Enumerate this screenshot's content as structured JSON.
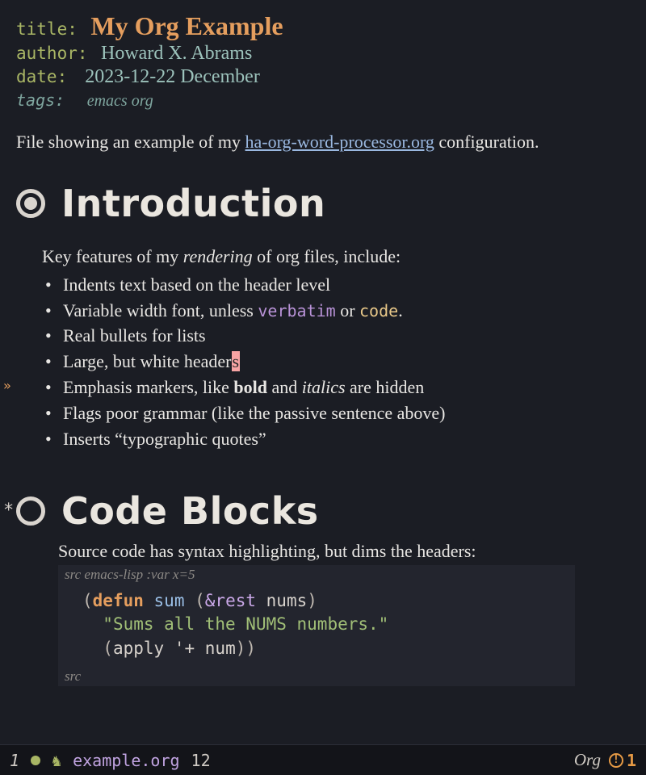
{
  "meta": {
    "title_key": "title:",
    "title_val": "My Org Example",
    "author_key": "author:",
    "author_val": "Howard X. Abrams",
    "date_key": "date:",
    "date_val": "2023-12-22 December",
    "tags_key": "tags:",
    "tags_val": "emacs org"
  },
  "intro_para_pre": "File showing an example of my ",
  "intro_link_text": "ha-org-word-processor.org",
  "intro_para_post": " configuration.",
  "section1": {
    "heading": "Introduction",
    "lead_pre": "Key features of my ",
    "lead_em": "rendering",
    "lead_post": " of org files, include:",
    "items": {
      "i0": "Indents text based on the header level",
      "i1_pre": "Variable width font, unless ",
      "i1_verb": "verbatim",
      "i1_mid": " or ",
      "i1_code": "code",
      "i1_post": ".",
      "i2": "Real bullets for lists",
      "i3_pre": "Large, but white header",
      "i3_cursor": "s",
      "i4_pre": "Emphasis markers, like ",
      "i4_bold": "bold",
      "i4_mid": " and ",
      "i4_ital": "italics",
      "i4_post": " are hidden",
      "i5": "Flags poor grammar (like the passive sentence above)",
      "i6": "Inserts “typographic quotes”"
    }
  },
  "section2": {
    "heading": "Code Blocks",
    "lead": "Source code has syntax highlighting, but dims the headers:",
    "src_header_kw": "src",
    "src_header_rest": " emacs-lisp :var x=5",
    "src_footer": "src",
    "code": {
      "l1_open": "(",
      "l1_defun": "defun",
      "l1_sp1": " ",
      "l1_fname": "sum",
      "l1_sp2": " ",
      "l1_open2": "(",
      "l1_amp": "&rest",
      "l1_sp3": " ",
      "l1_arg": "nums",
      "l1_close": ")",
      "l2_str": "\"Sums all the NUMS numbers.\"",
      "l3_open": "(",
      "l3_apply": "apply",
      "l3_sp": " ",
      "l3_quote": "'+",
      "l3_sp2": " ",
      "l3_arg": "num",
      "l3_close": "))"
    }
  },
  "fringe_arrow": "»",
  "modeline": {
    "winnum": "1",
    "horse": "♞",
    "filename": "example.org",
    "line": "12",
    "major_mode": "Org",
    "warn_count": "1",
    "warn_glyph": "!"
  }
}
